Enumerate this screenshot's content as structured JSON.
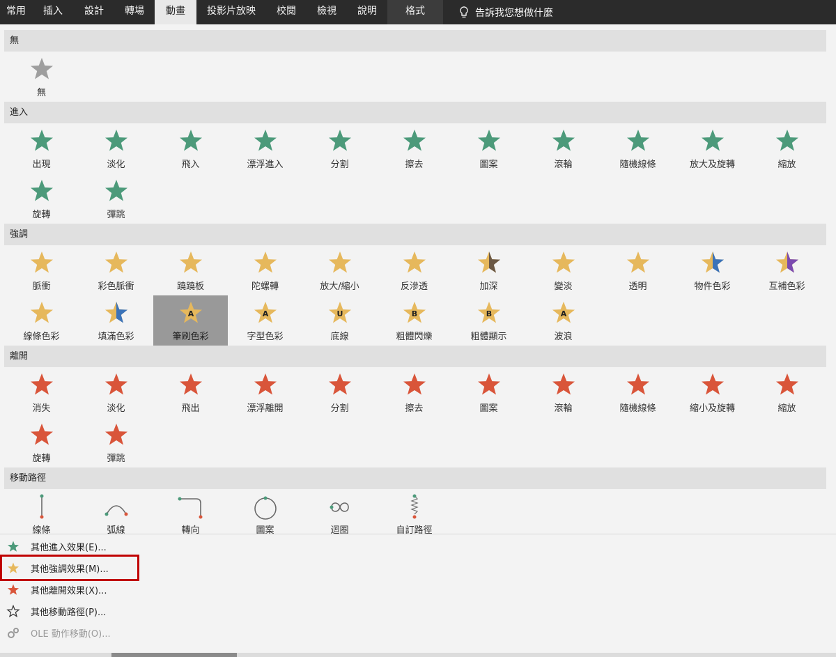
{
  "tabs": [
    "常用",
    "插入",
    "設計",
    "轉場",
    "動畫",
    "投影片放映",
    "校閱",
    "檢視",
    "說明",
    "格式"
  ],
  "active_tab": "動畫",
  "tell_me": "告訴我您想做什麼",
  "colors": {
    "entrance": "#4c9a7a",
    "emphasis": "#e6b85c",
    "exit": "#d9553a",
    "none": "#9e9e9e",
    "path": "#6a6a6a"
  },
  "sections": {
    "none": {
      "title": "無",
      "items": [
        "無"
      ]
    },
    "entrance": {
      "title": "進入",
      "items": [
        "出現",
        "淡化",
        "飛入",
        "漂浮進入",
        "分割",
        "擦去",
        "圖案",
        "滾輪",
        "隨機線條",
        "放大及旋轉",
        "縮放",
        "旋轉",
        "彈跳"
      ]
    },
    "emphasis": {
      "title": "強調",
      "items": [
        "脈衝",
        "彩色脈衝",
        "蹺蹺板",
        "陀螺轉",
        "放大/縮小",
        "反滲透",
        "加深",
        "變淡",
        "透明",
        "物件色彩",
        "互補色彩",
        "線條色彩",
        "填滿色彩",
        "筆刷色彩",
        "字型色彩",
        "底線",
        "粗體閃爍",
        "粗體顯示",
        "波浪"
      ]
    },
    "exit": {
      "title": "離開",
      "items": [
        "消失",
        "淡化",
        "飛出",
        "漂浮離開",
        "分割",
        "擦去",
        "圖案",
        "滾輪",
        "隨機線條",
        "縮小及旋轉",
        "縮放",
        "旋轉",
        "彈跳"
      ]
    },
    "motion": {
      "title": "移動路徑",
      "items": [
        "線條",
        "弧線",
        "轉向",
        "圖案",
        "迴圈",
        "自訂路徑"
      ]
    }
  },
  "selected_item": "筆刷色彩",
  "menu": [
    {
      "label": "其他進入效果(E)...",
      "icon": "green-star-icon"
    },
    {
      "label": "其他強調效果(M)...",
      "icon": "gold-star-icon"
    },
    {
      "label": "其他離開效果(X)...",
      "icon": "red-star-icon"
    },
    {
      "label": "其他移動路徑(P)...",
      "icon": "outline-star-icon"
    },
    {
      "label": "OLE 動作移動(O)...",
      "icon": "gears-icon"
    }
  ]
}
